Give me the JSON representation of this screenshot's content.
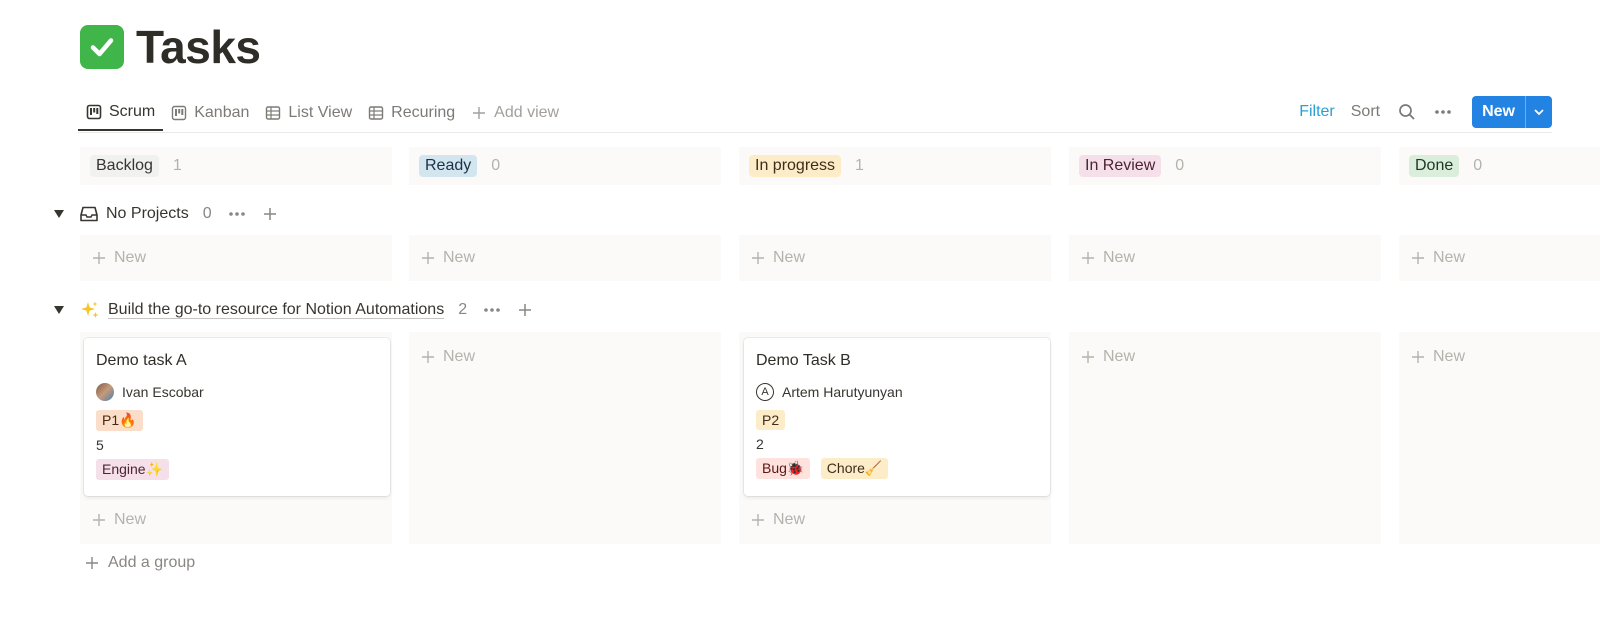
{
  "page": {
    "title": "Tasks",
    "title_icon": "check-mark-button-icon"
  },
  "tabs": [
    {
      "label": "Scrum",
      "icon": "board-icon",
      "active": true
    },
    {
      "label": "Kanban",
      "icon": "board-icon"
    },
    {
      "label": "List View",
      "icon": "table-icon"
    },
    {
      "label": "Recuring",
      "icon": "table-icon"
    },
    {
      "label": "Add view",
      "icon": "plus-icon"
    }
  ],
  "toolbar": {
    "filter": "Filter",
    "sort": "Sort",
    "new_label": "New"
  },
  "columns": [
    {
      "label": "Backlog",
      "count": "1",
      "color": "#f1f1ef"
    },
    {
      "label": "Ready",
      "count": "0",
      "color": "#d3e5ef"
    },
    {
      "label": "In progress",
      "count": "1",
      "color": "#fdecc8"
    },
    {
      "label": "In Review",
      "count": "0",
      "color": "#f5e0e9"
    },
    {
      "label": "Done",
      "count": "0",
      "color": "#dbeddb"
    }
  ],
  "groups": [
    {
      "title": "No Projects",
      "count": "0",
      "icon": "inbox-icon"
    },
    {
      "title": "Build the go-to resource for Notion Automations",
      "count": "2",
      "icon": "sparkles-icon"
    }
  ],
  "new_label": "New",
  "cards": [
    {
      "title": "Demo task A",
      "assignee": "Ivan Escobar",
      "priority": "P1🔥",
      "points": "5",
      "tags": [
        "Engine✨"
      ]
    },
    {
      "title": "Demo Task B",
      "assignee": "Artem Harutyunyan",
      "assignee_initial": "A",
      "priority": "P2",
      "points": "2",
      "tags": [
        "Bug🐞",
        "Chore🧹"
      ]
    }
  ],
  "add_group_label": "Add a group",
  "colors": {
    "accent": "#2383e2",
    "filter": "#2a9fd6",
    "priority_p1": "#fadec9",
    "priority_p2": "#fdecc8",
    "tag_engine": "#f5e0e9",
    "tag_bug": "#ffe2dd",
    "tag_chore": "#fdecc8"
  }
}
